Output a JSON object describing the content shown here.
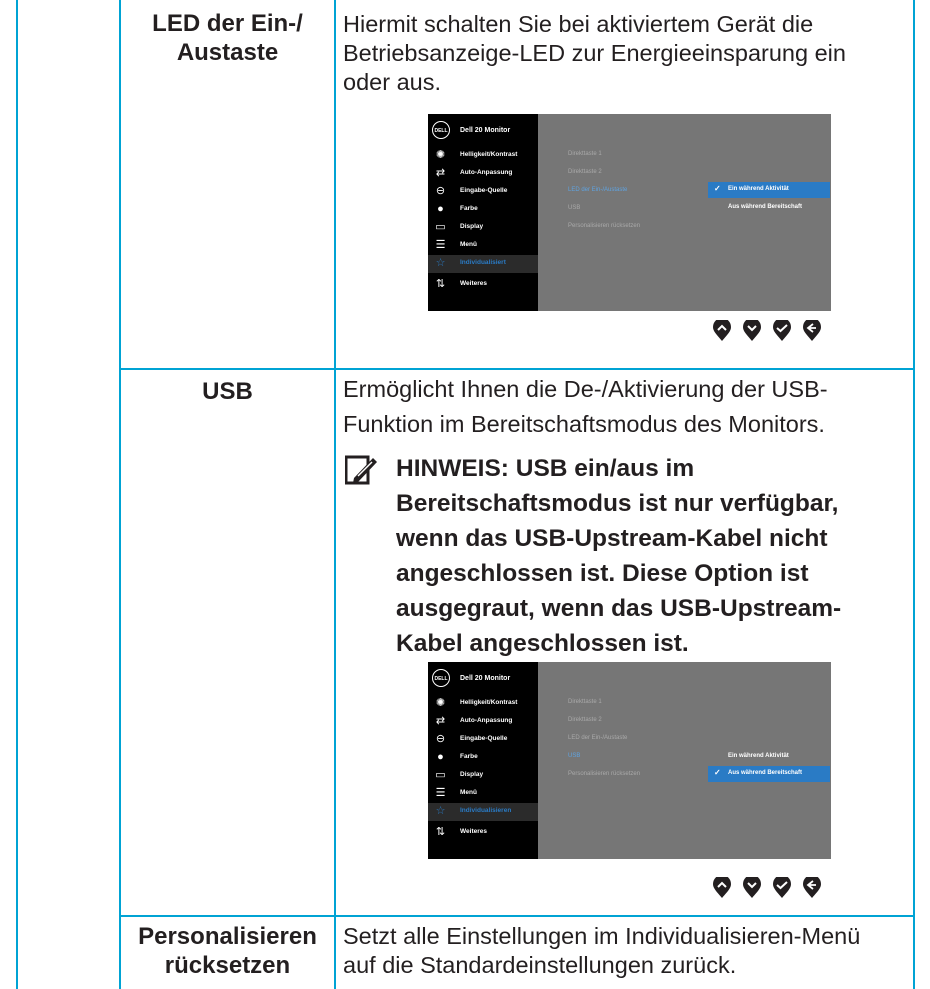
{
  "rows": [
    {
      "name": "LED der Ein-/\nAustaste",
      "description": "Hiermit schalten Sie bei aktiviertem Gerät die\nBetriebsanzeige-LED zur Energieeinsparung ein\noder aus."
    },
    {
      "name": "USB",
      "description": "Ermöglicht Ihnen die De-/Aktivierung der USB-\nFunktion im Bereitschaftsmodus des Monitors.",
      "note": "HINWEIS: USB ein/aus im\nBereitschaftsmodus ist nur verfügbar,\nwenn das USB-Upstream-Kabel nicht\nangeschlossen ist. Diese Option ist\nausgegraut, wenn das USB-Upstream-\nKabel angeschlossen ist."
    },
    {
      "name": "Personalisieren\nrücksetzen",
      "description": "Setzt alle Einstellungen im Individualisieren-Menü\nauf die Standardeinstellungen zurück."
    }
  ],
  "osd": {
    "logo": "DELL",
    "title": "Dell 20 Monitor",
    "menu": [
      {
        "label": "Helligkeit/Kontrast",
        "icon": "brightness-icon"
      },
      {
        "label": "Auto-Anpassung",
        "icon": "auto-adjust-icon"
      },
      {
        "label": "Eingabe-Quelle",
        "icon": "input-source-icon"
      },
      {
        "label": "Farbe",
        "icon": "color-icon"
      },
      {
        "label": "Display",
        "icon": "display-icon"
      },
      {
        "label": "Menü",
        "icon": "menu-icon"
      },
      {
        "label": "Individualisiert",
        "icon": "star-icon"
      },
      {
        "label": "Weiteres",
        "icon": "others-icon"
      }
    ],
    "menu_bottom": [
      {
        "label": "Helligkeit/Kontrast"
      },
      {
        "label": "Auto-Anpassung"
      },
      {
        "label": "Eingabe-Quelle"
      },
      {
        "label": "Farbe"
      },
      {
        "label": "Display"
      },
      {
        "label": "Menü"
      },
      {
        "label": "Individualisieren"
      },
      {
        "label": "Weiteres"
      }
    ],
    "submenu": [
      "Direkttaste 1",
      "Direkttaste 2",
      "LED der Ein-/Austaste",
      "USB",
      "Personalisieren rücksetzen"
    ],
    "options": [
      "Ein während Aktivität",
      "Aus während Bereitschaft"
    ],
    "check": "✓"
  },
  "colors": {
    "border": "#00a3d4",
    "osd_highlight": "#2a7bc5",
    "osd_background": "#767676"
  }
}
